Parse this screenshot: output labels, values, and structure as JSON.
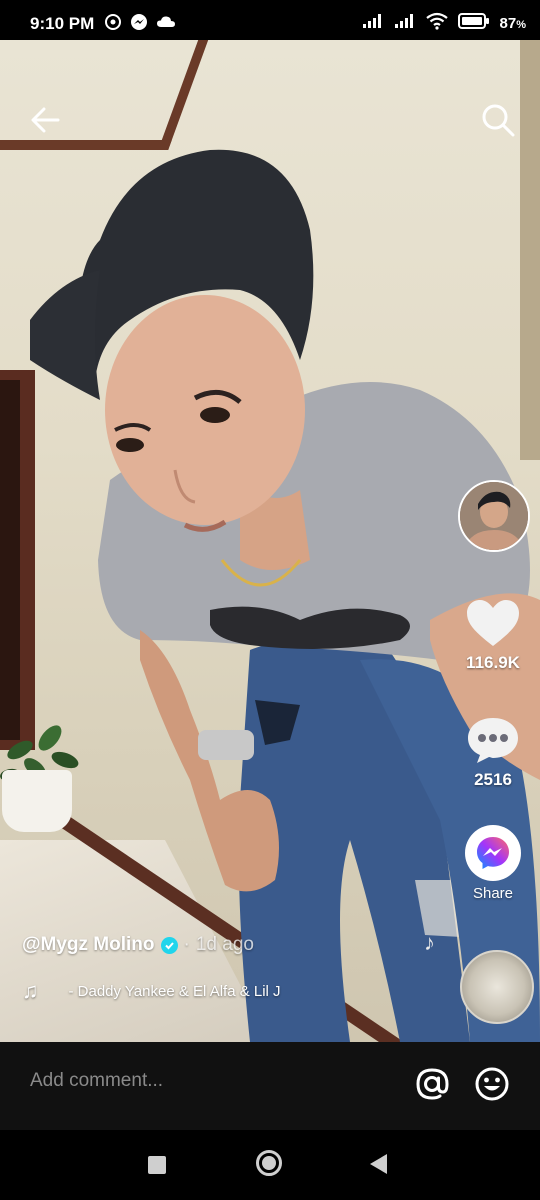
{
  "status_bar": {
    "time": "9:10 PM",
    "battery": "87",
    "battery_unit": "%"
  },
  "header": {
    "back_icon": "back-arrow-icon",
    "search_icon": "search-icon"
  },
  "actions": {
    "likes": "116.9K",
    "comments": "2516",
    "share_label": "Share"
  },
  "caption": {
    "username": "@Mygz Molino",
    "separator": "·",
    "posted": "1d ago"
  },
  "music": {
    "sound": "- Daddy Yankee & El Alfa & Lil J"
  },
  "comment_bar": {
    "placeholder": "Add comment..."
  },
  "colors": {
    "verified": "#20d5ec",
    "comment_bar_bg": "#111111",
    "messenger_gradient_start": "#0695ff",
    "messenger_gradient_end": "#ff6968"
  }
}
